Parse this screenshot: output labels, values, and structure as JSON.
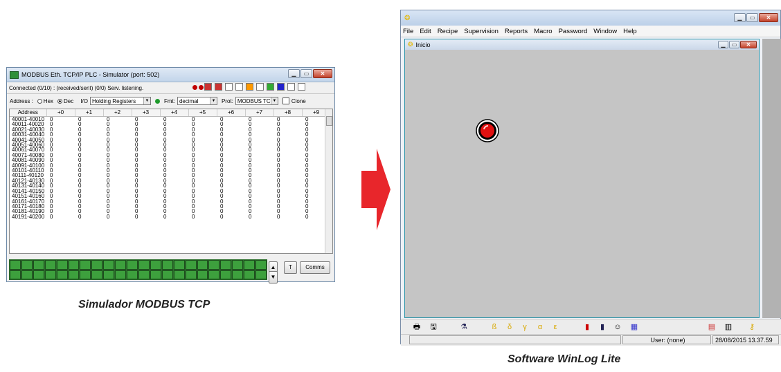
{
  "simulator": {
    "title": "MODBUS Eth. TCP/IP PLC - Simulator (port: 502)",
    "status": "Connected (0/10) : (received/sent) (0/0) Serv. listening.",
    "address_label": "Address :",
    "hex_label": "Hex",
    "dec_label": "Dec",
    "io_label": "I/O",
    "io_value": "Holding Registers",
    "fmt_label": "Fmt:",
    "fmt_value": "decimal",
    "prot_label": "Prot:",
    "prot_value": "MODBUS TCP",
    "clone_label": "Clone",
    "grid_header": [
      "Address",
      "+0",
      "+1",
      "+2",
      "+3",
      "+4",
      "+5",
      "+6",
      "+7",
      "+8",
      "+9"
    ],
    "rows": [
      "40001-40010",
      "40011-40020",
      "40021-40030",
      "40031-40040",
      "40041-40050",
      "40051-40060",
      "40061-40070",
      "40071-40080",
      "40081-40090",
      "40091-40100",
      "40101-40110",
      "40111-40120",
      "40121-40130",
      "40131-40140",
      "40141-40150",
      "40151-40160",
      "40161-40170",
      "40171-40180",
      "40181-40190",
      "40191-40200"
    ],
    "cell_value": "0",
    "t_button": "T",
    "comms_button": "Comms"
  },
  "caption_left": "Simulador MODBUS TCP",
  "winlog": {
    "menu": [
      "File",
      "Edit",
      "Recipe",
      "Supervision",
      "Reports",
      "Macro",
      "Password",
      "Window",
      "Help"
    ],
    "child_title": "Inicio",
    "user": "User: (none)",
    "datetime": "28/08/2015  13.37.59"
  },
  "caption_right": "Software WinLog Lite",
  "colors": {
    "arrow": "#e8262b",
    "lamp": "#e01010",
    "led": "#3da03d"
  }
}
